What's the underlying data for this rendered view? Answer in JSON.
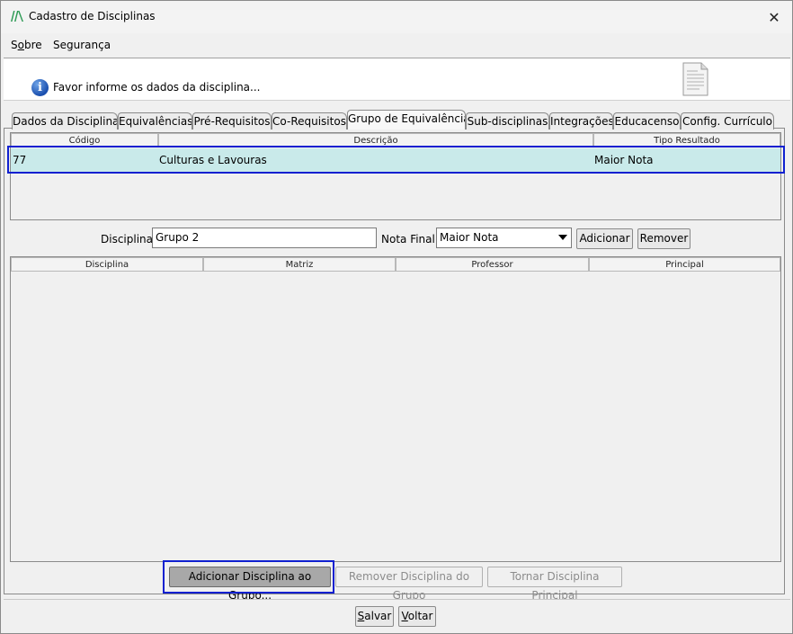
{
  "window": {
    "title": "Cadastro de Disciplinas",
    "close_glyph": "✕"
  },
  "menu": {
    "items": [
      {
        "label_pre": "S",
        "label_u": "o",
        "label_post": "bre"
      },
      {
        "label": "Segurança"
      }
    ]
  },
  "header": {
    "info_text": "Favor informe os dados da disciplina..."
  },
  "tabs": [
    {
      "label": "Dados da Disciplina"
    },
    {
      "label": "Equivalências"
    },
    {
      "label": "Pré-Requisitos"
    },
    {
      "label": "Co-Requisitos"
    },
    {
      "label": "Grupo de Equivalência",
      "active": true
    },
    {
      "label": "Sub-disciplinas"
    },
    {
      "label": "Integrações"
    },
    {
      "label": "Educacenso"
    },
    {
      "label": "Config. Currículo"
    }
  ],
  "groups_table": {
    "columns": [
      "Código",
      "Descrição",
      "Tipo Resultado"
    ],
    "rows": [
      {
        "codigo": "77",
        "descricao": "Culturas e Lavouras",
        "tipo": "Maior Nota",
        "selected": true
      }
    ]
  },
  "form": {
    "disciplina_label": "Disciplina",
    "disciplina_value": "Grupo 2",
    "nota_final_label": "Nota Final:",
    "nota_final_value": "Maior Nota",
    "adicionar_label": "Adicionar",
    "remover_label": "Remover"
  },
  "disciplines_table": {
    "columns": [
      "Disciplina",
      "Matriz",
      "Professor",
      "Principal"
    ],
    "rows": []
  },
  "group_actions": {
    "add_label": "Adicionar Disciplina ao Grupo...",
    "remove_label": "Remover Disciplina do Grupo",
    "principal_label": "Tornar Disciplina Principal"
  },
  "footer": {
    "salvar_u": "S",
    "salvar_rest": "alvar",
    "voltar_u": "V",
    "voltar_rest": "oltar"
  },
  "colors": {
    "selected_row": "#c9eaea",
    "highlight_border": "#1020d0",
    "info_icon": "#1a4fae"
  },
  "icons": {
    "app": "app-logo-icon",
    "info": "info-icon",
    "document": "document-icon",
    "close": "close-icon",
    "dropdown": "chevron-down-icon"
  }
}
